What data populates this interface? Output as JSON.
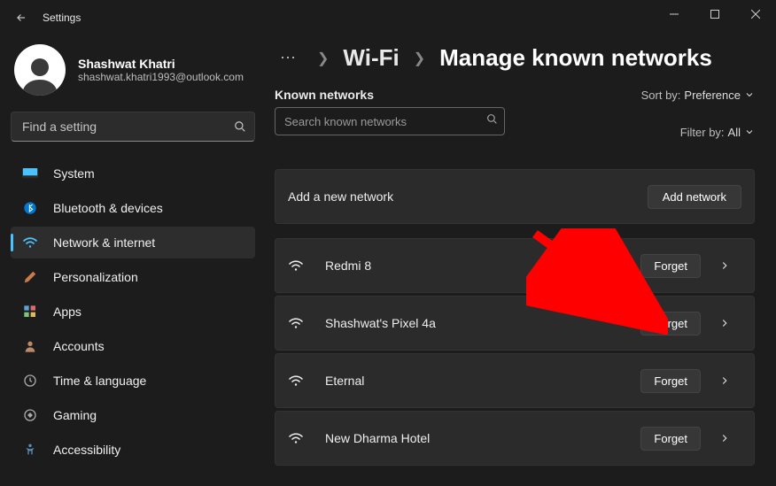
{
  "window": {
    "title": "Settings"
  },
  "profile": {
    "name": "Shashwat Khatri",
    "email": "shashwat.khatri1993@outlook.com"
  },
  "search": {
    "placeholder": "Find a setting"
  },
  "nav": {
    "items": [
      {
        "label": "System"
      },
      {
        "label": "Bluetooth & devices"
      },
      {
        "label": "Network & internet"
      },
      {
        "label": "Personalization"
      },
      {
        "label": "Apps"
      },
      {
        "label": "Accounts"
      },
      {
        "label": "Time & language"
      },
      {
        "label": "Gaming"
      },
      {
        "label": "Accessibility"
      }
    ],
    "active_index": 2
  },
  "breadcrumb": {
    "more": "⋯",
    "link": "Wi-Fi",
    "current": "Manage known networks"
  },
  "known": {
    "section_title": "Known networks",
    "search_placeholder": "Search known networks",
    "sort_label": "Sort by:",
    "sort_value": "Preference",
    "filter_label": "Filter by:",
    "filter_value": "All",
    "add_label": "Add a new network",
    "add_button": "Add network",
    "forget_label": "Forget",
    "networks": [
      {
        "name": "Redmi 8"
      },
      {
        "name": "Shashwat's Pixel 4a"
      },
      {
        "name": "Eternal"
      },
      {
        "name": "New Dharma Hotel"
      }
    ]
  }
}
